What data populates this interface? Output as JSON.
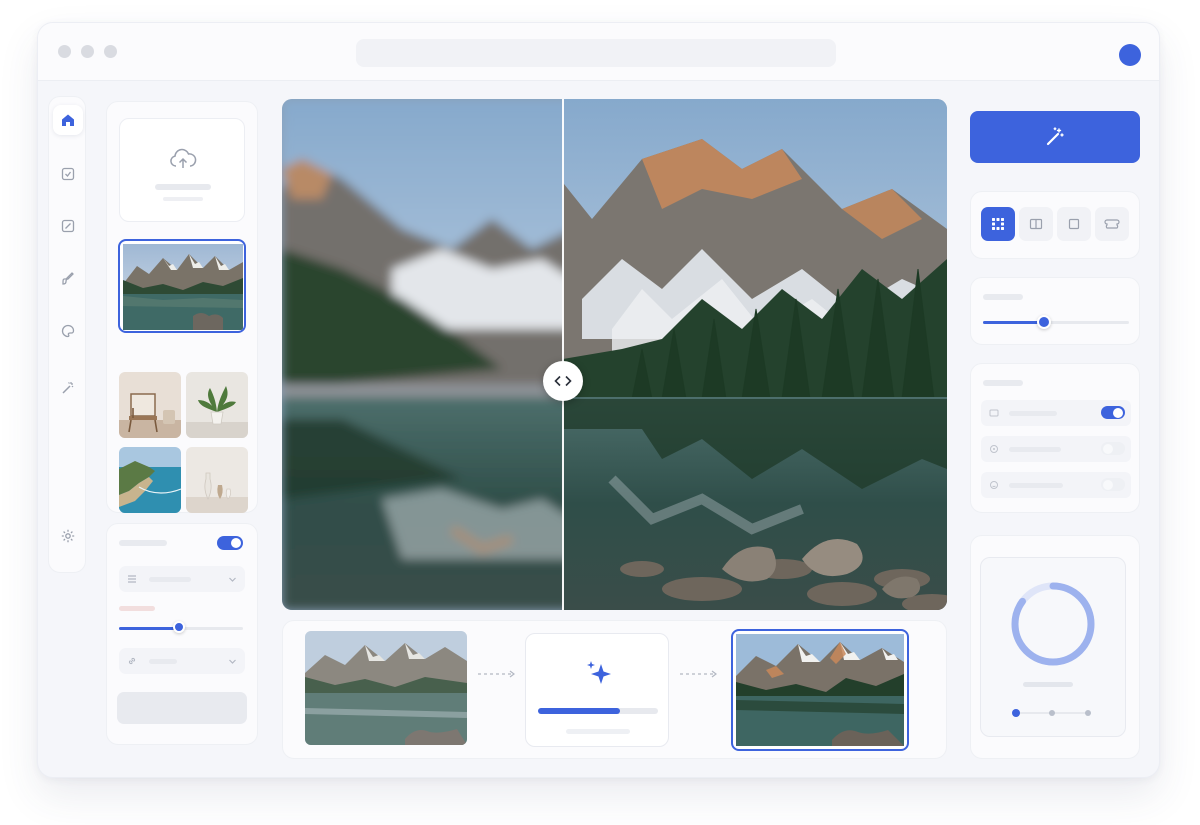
{
  "window": {
    "controls": [
      "close",
      "minimize",
      "maximize"
    ],
    "accent_color": "#3d63dd"
  },
  "sidebar": {
    "items": [
      {
        "icon": "home-icon",
        "active": true
      },
      {
        "icon": "check-box-icon",
        "active": false
      },
      {
        "icon": "edit-icon",
        "active": false
      },
      {
        "icon": "brush-icon",
        "active": false
      },
      {
        "icon": "palette-icon",
        "active": false
      },
      {
        "icon": "magic-wand-icon",
        "active": false
      },
      {
        "icon": "settings-icon",
        "active": false
      }
    ]
  },
  "library": {
    "upload_icon": "cloud-upload-icon",
    "thumbnails": [
      "mountain-lake",
      "chair-interior",
      "potted-plant",
      "coastline",
      "vases"
    ],
    "selected": "mountain-lake"
  },
  "adjustments": {
    "toggle_on": true,
    "slider_level": 0.5
  },
  "compare": {
    "handle_icon": "chevron-left-right-icon",
    "split_position": 0.42
  },
  "pipeline": {
    "steps": [
      "before-image",
      "ai-processing",
      "after-image"
    ],
    "processing_icon": "sparkles-icon",
    "progress": 0.6
  },
  "tools": {
    "magic_button_icon": "magic-wand-icon",
    "modes": [
      "grid-icon",
      "book-icon",
      "square-icon",
      "frame-icon"
    ],
    "active_mode": "grid-icon",
    "intensity": 0.4,
    "options": [
      {
        "icon": "image-icon",
        "enabled": true
      },
      {
        "icon": "circle-icon",
        "enabled": false
      },
      {
        "icon": "face-icon",
        "enabled": false
      }
    ],
    "ring_progress": 0.85,
    "steps_active": 1,
    "steps_total": 3
  }
}
